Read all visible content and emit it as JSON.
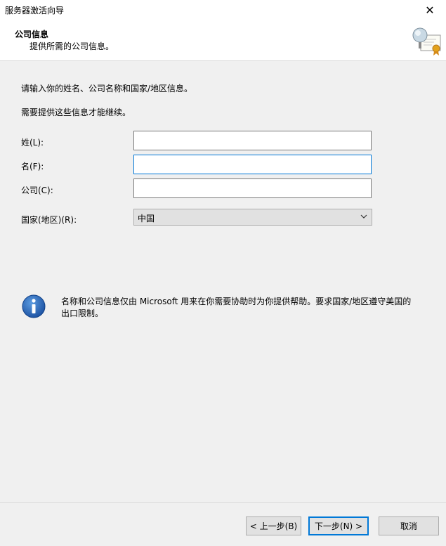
{
  "window": {
    "title": "服务器激活向导",
    "close_symbol": "✕"
  },
  "header": {
    "title": "公司信息",
    "subtitle": "提供所需的公司信息。",
    "icon": "certificate-icon"
  },
  "intro": {
    "line1": "请输入你的姓名、公司名称和国家/地区信息。",
    "line2": "需要提供这些信息才能继续。"
  },
  "form": {
    "last_name": {
      "label": "姓(L):",
      "value": ""
    },
    "first_name": {
      "label": "名(F):",
      "value": ""
    },
    "company": {
      "label": "公司(C):",
      "value": ""
    },
    "country": {
      "label": "国家(地区)(R):",
      "value": "中国"
    }
  },
  "info": {
    "icon": "info-icon",
    "text": "名称和公司信息仅由 Microsoft 用来在你需要协助时为你提供帮助。要求国家/地区遵守美国的出口限制。"
  },
  "buttons": {
    "back": "< 上一步(B)",
    "next": "下一步(N) >",
    "cancel": "取消"
  },
  "colors": {
    "accent": "#0078d7",
    "info_blue": "#1a5fb4"
  }
}
